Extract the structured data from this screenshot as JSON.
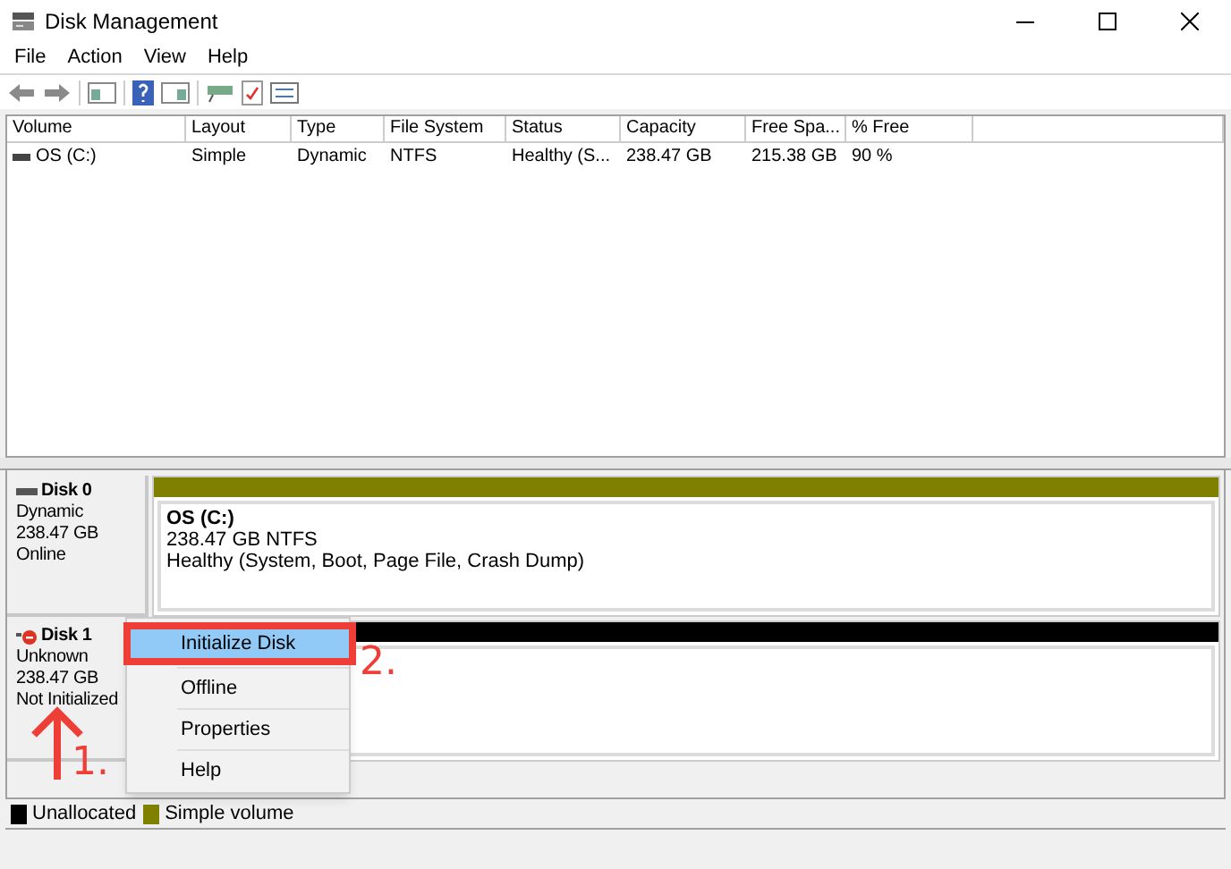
{
  "window": {
    "title": "Disk Management"
  },
  "menu": [
    "File",
    "Action",
    "View",
    "Help"
  ],
  "volume_list": {
    "columns": [
      "Volume",
      "Layout",
      "Type",
      "File System",
      "Status",
      "Capacity",
      "Free Spa...",
      "% Free"
    ],
    "rows": [
      [
        "OS (C:)",
        "Simple",
        "Dynamic",
        "NTFS",
        "Healthy (S...",
        "238.47 GB",
        "215.38 GB",
        "90 %"
      ]
    ]
  },
  "disks": [
    {
      "name": "Disk 0",
      "kind": "online",
      "type": "Dynamic",
      "size": "238.47 GB",
      "status": "Online",
      "partition": {
        "color": "#808000",
        "title": "OS  (C:)",
        "size": "238.47 GB NTFS",
        "status": "Healthy (System, Boot, Page File, Crash Dump)"
      }
    },
    {
      "name": "Disk 1",
      "kind": "error",
      "type": "Unknown",
      "size": "238.47 GB",
      "status": "Not Initialized",
      "partition": {
        "color": "#000000"
      }
    }
  ],
  "context_menu": [
    {
      "label": "Initialize Disk",
      "selected": true
    },
    {
      "label": "Offline",
      "selected": false
    },
    {
      "label": "Properties",
      "selected": false
    },
    {
      "label": "Help",
      "selected": false
    }
  ],
  "annotations": [
    "1.",
    "2."
  ],
  "legend": [
    {
      "label": "Unallocated",
      "color": "#000000"
    },
    {
      "label": "Simple volume",
      "color": "#808000"
    }
  ]
}
